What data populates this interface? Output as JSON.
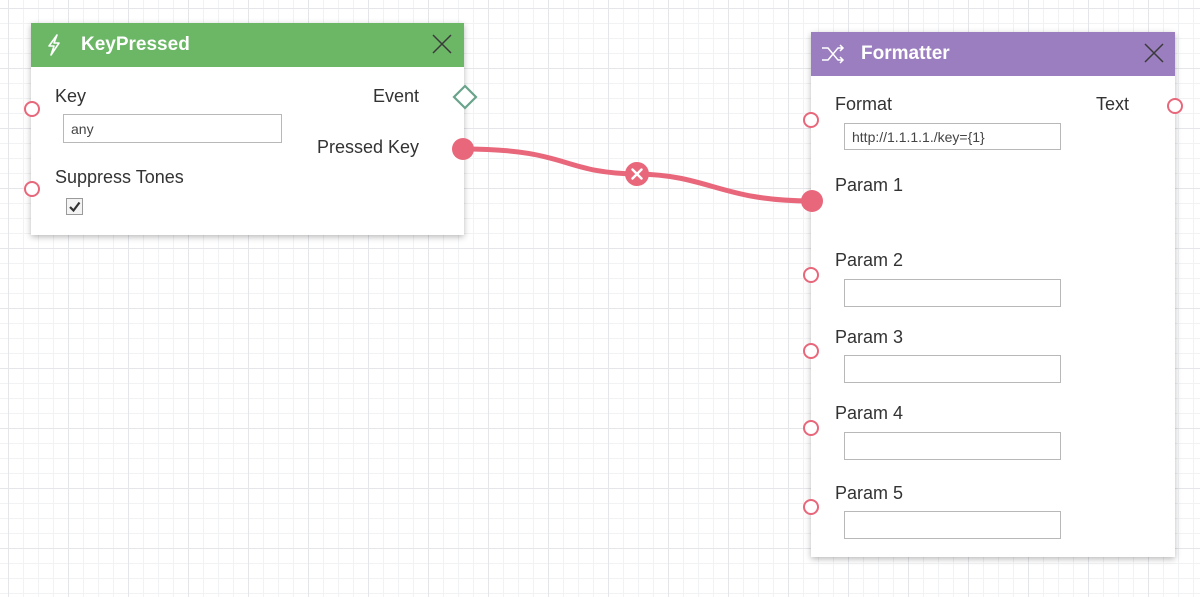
{
  "colors": {
    "keypressed_header": "#6bb766",
    "formatter_header": "#9b7ec0",
    "connection": "#e8677b",
    "event_port": "#6aa38c"
  },
  "keypressed": {
    "title": "KeyPressed",
    "icon": "lightning-icon",
    "inputs": {
      "key_label": "Key",
      "key_value": "any",
      "suppress_label": "Suppress Tones",
      "suppress_checked": true
    },
    "outputs": {
      "event_label": "Event",
      "pressed_key_label": "Pressed Key"
    }
  },
  "formatter": {
    "title": "Formatter",
    "icon": "shuffle-icon",
    "format_label": "Format",
    "format_value": "http://1.1.1.1./key={1}",
    "text_label": "Text",
    "params": [
      {
        "label": "Param 1",
        "value": ""
      },
      {
        "label": "Param 2",
        "value": ""
      },
      {
        "label": "Param 3",
        "value": ""
      },
      {
        "label": "Param 4",
        "value": ""
      },
      {
        "label": "Param 5",
        "value": ""
      }
    ]
  },
  "connection": {
    "from": "KeyPressed.Pressed Key",
    "to": "Formatter.Param 1"
  }
}
